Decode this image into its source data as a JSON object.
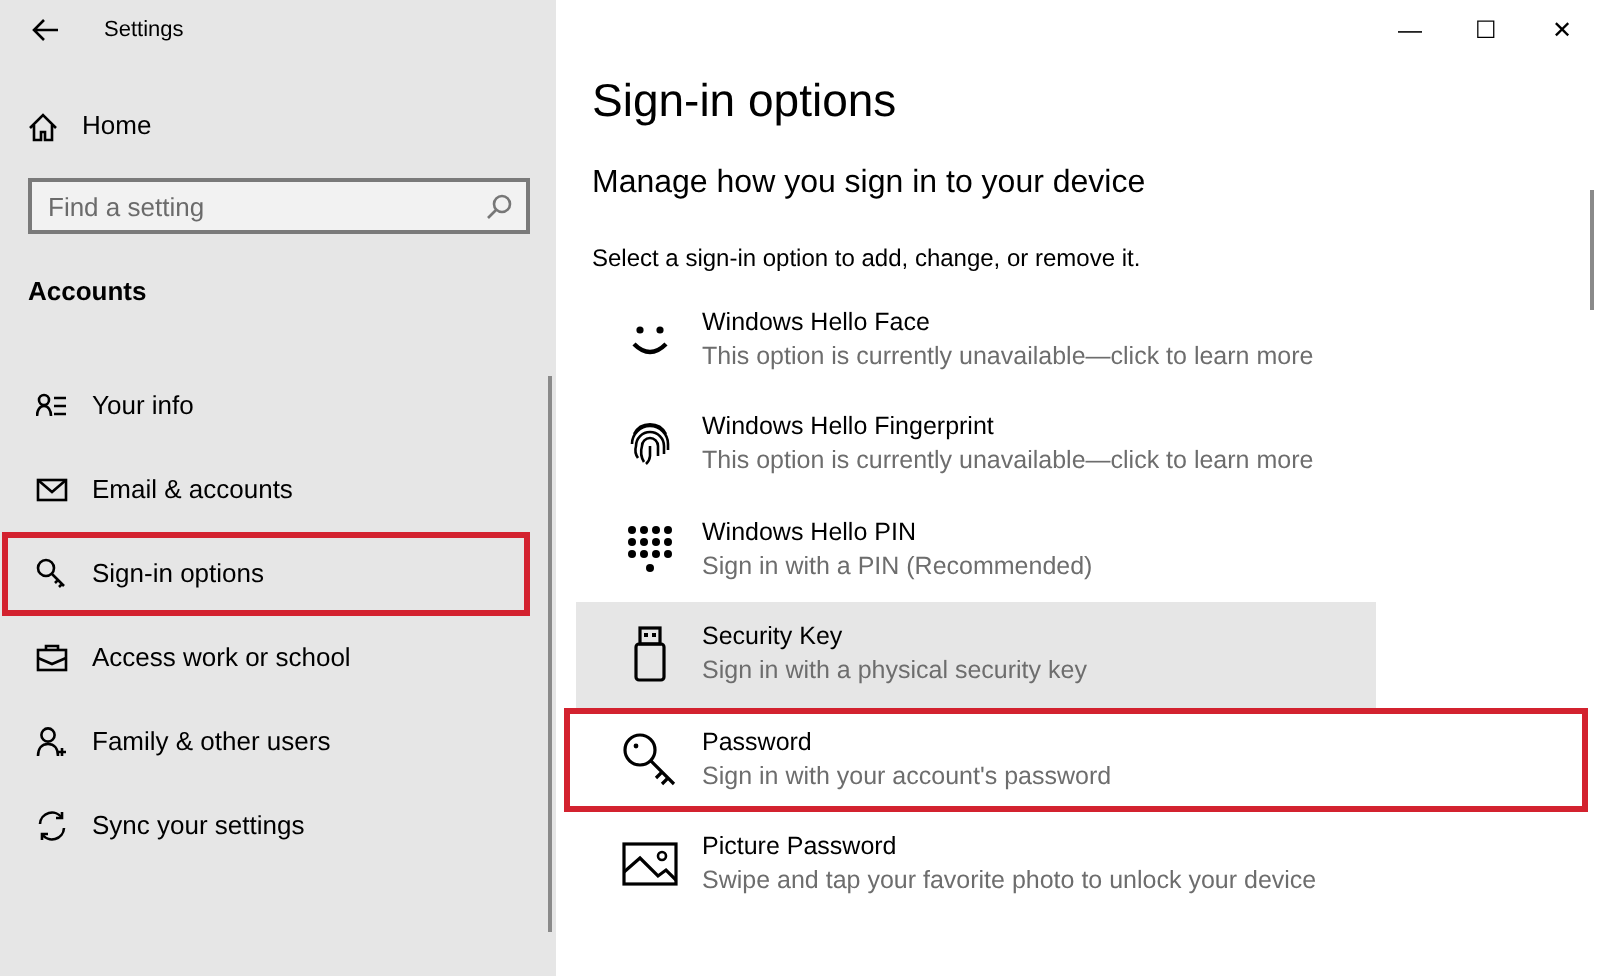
{
  "window": {
    "title": "Settings",
    "controls": [
      "—",
      "☐",
      "✕"
    ]
  },
  "sidebar": {
    "home": "Home",
    "search": {
      "placeholder": "Find a setting"
    },
    "section": "Accounts",
    "items": [
      {
        "kind": "info",
        "label": "Your info",
        "highlighted": false
      },
      {
        "kind": "mail",
        "label": "Email & accounts",
        "highlighted": false
      },
      {
        "kind": "key",
        "label": "Sign-in options",
        "highlighted": true
      },
      {
        "kind": "briefcase",
        "label": "Access work or school",
        "highlighted": false
      },
      {
        "kind": "people",
        "label": "Family & other users",
        "highlighted": false
      },
      {
        "kind": "sync",
        "label": "Sync your settings",
        "highlighted": false
      }
    ]
  },
  "page": {
    "title": "Sign-in options",
    "subtitle": "Manage how you sign in to your device",
    "intro": "Select a sign-in option to add, change, or remove it.",
    "options": [
      {
        "kind": "face",
        "title": "Windows Hello Face",
        "description": "This option is currently unavailable—click to learn more",
        "hovered": false,
        "highlighted": false
      },
      {
        "kind": "fingerprint",
        "title": "Windows Hello Fingerprint",
        "description": "This option is currently unavailable—click to learn more",
        "hovered": false,
        "highlighted": false
      },
      {
        "kind": "pin",
        "title": "Windows Hello PIN",
        "description": "Sign in with a PIN (Recommended)",
        "hovered": false,
        "highlighted": false
      },
      {
        "kind": "usb",
        "title": "Security Key",
        "description": "Sign in with a physical security key",
        "hovered": true,
        "highlighted": false
      },
      {
        "kind": "password",
        "title": "Password",
        "description": "Sign in with your account's password",
        "hovered": false,
        "highlighted": true
      },
      {
        "kind": "picture",
        "title": "Picture Password",
        "description": "Swipe and tap your favorite photo to unlock your device",
        "hovered": false,
        "highlighted": false
      }
    ]
  }
}
